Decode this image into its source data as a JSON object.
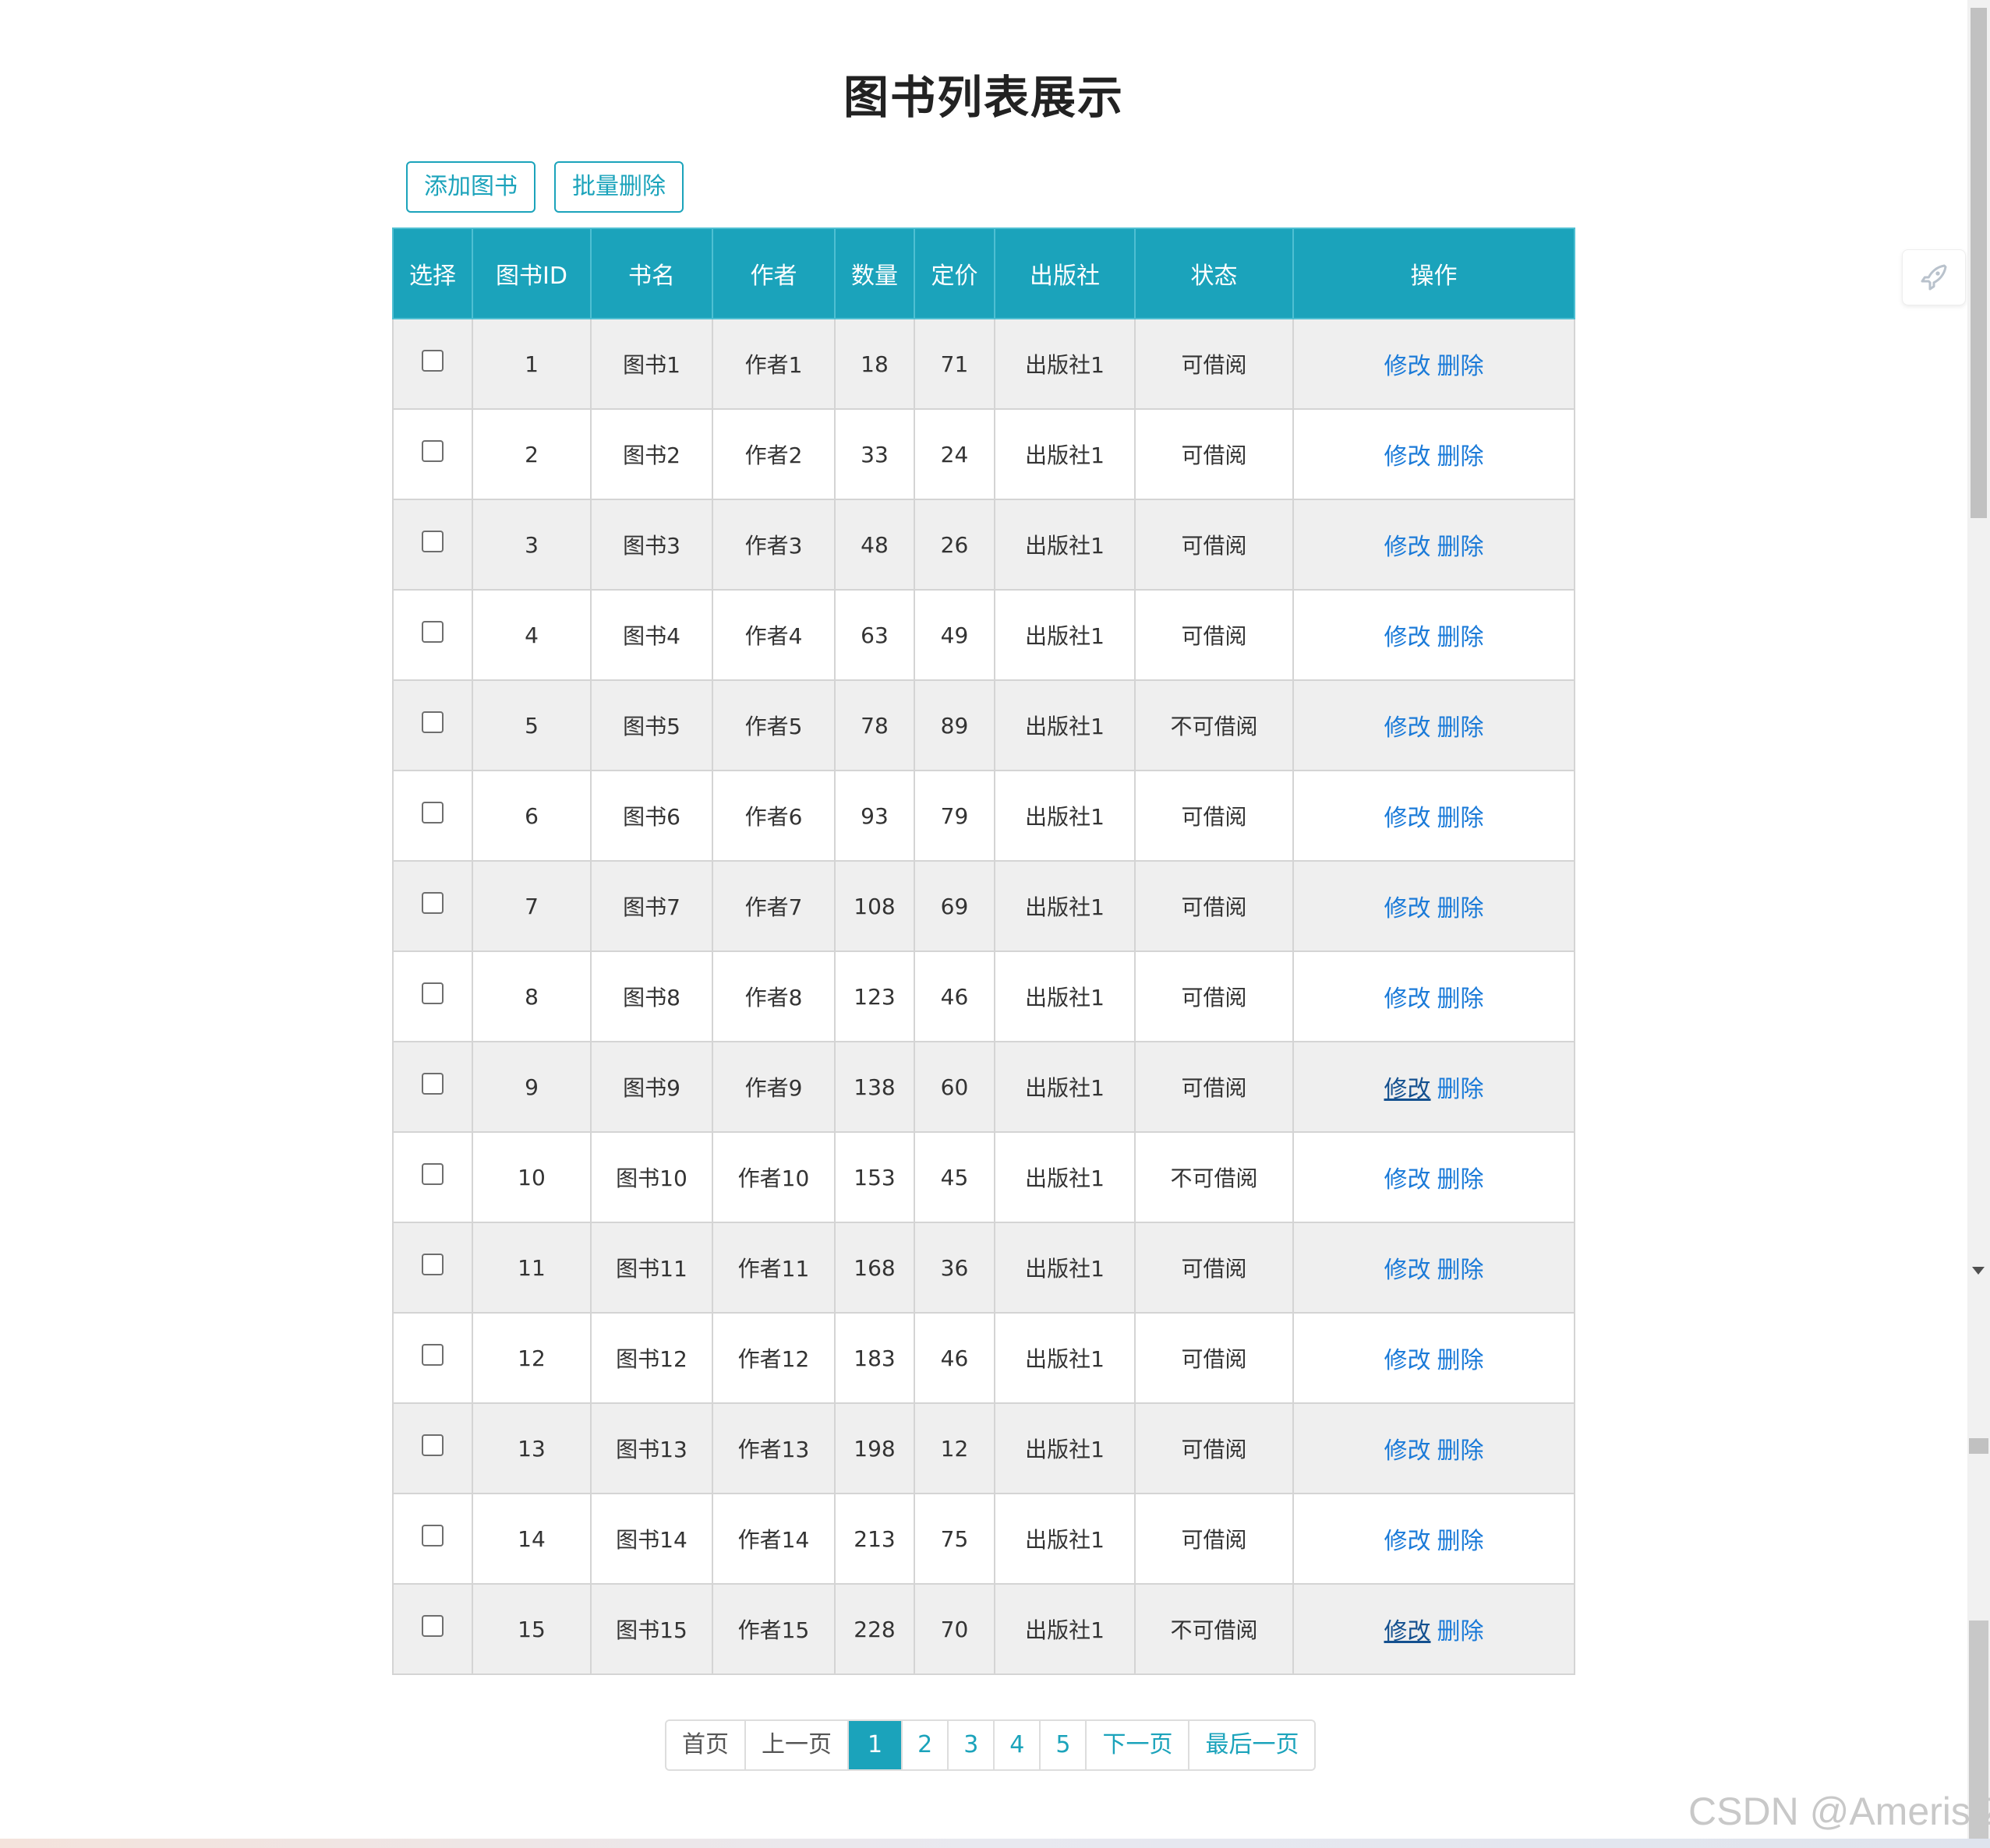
{
  "page": {
    "title": "图书列表展示"
  },
  "toolbar": {
    "add_label": "添加图书",
    "batch_delete_label": "批量删除"
  },
  "table": {
    "headers": [
      "选择",
      "图书ID",
      "书名",
      "作者",
      "数量",
      "定价",
      "出版社",
      "状态",
      "操作"
    ],
    "edit_label": "修改",
    "delete_label": "删除",
    "rows": [
      {
        "id": "1",
        "name": "图书1",
        "author": "作者1",
        "count": "18",
        "price": "71",
        "publisher": "出版社1",
        "status": "可借阅"
      },
      {
        "id": "2",
        "name": "图书2",
        "author": "作者2",
        "count": "33",
        "price": "24",
        "publisher": "出版社1",
        "status": "可借阅"
      },
      {
        "id": "3",
        "name": "图书3",
        "author": "作者3",
        "count": "48",
        "price": "26",
        "publisher": "出版社1",
        "status": "可借阅"
      },
      {
        "id": "4",
        "name": "图书4",
        "author": "作者4",
        "count": "63",
        "price": "49",
        "publisher": "出版社1",
        "status": "可借阅"
      },
      {
        "id": "5",
        "name": "图书5",
        "author": "作者5",
        "count": "78",
        "price": "89",
        "publisher": "出版社1",
        "status": "不可借阅"
      },
      {
        "id": "6",
        "name": "图书6",
        "author": "作者6",
        "count": "93",
        "price": "79",
        "publisher": "出版社1",
        "status": "可借阅"
      },
      {
        "id": "7",
        "name": "图书7",
        "author": "作者7",
        "count": "108",
        "price": "69",
        "publisher": "出版社1",
        "status": "可借阅"
      },
      {
        "id": "8",
        "name": "图书8",
        "author": "作者8",
        "count": "123",
        "price": "46",
        "publisher": "出版社1",
        "status": "可借阅"
      },
      {
        "id": "9",
        "name": "图书9",
        "author": "作者9",
        "count": "138",
        "price": "60",
        "publisher": "出版社1",
        "status": "可借阅"
      },
      {
        "id": "10",
        "name": "图书10",
        "author": "作者10",
        "count": "153",
        "price": "45",
        "publisher": "出版社1",
        "status": "不可借阅"
      },
      {
        "id": "11",
        "name": "图书11",
        "author": "作者11",
        "count": "168",
        "price": "36",
        "publisher": "出版社1",
        "status": "可借阅"
      },
      {
        "id": "12",
        "name": "图书12",
        "author": "作者12",
        "count": "183",
        "price": "46",
        "publisher": "出版社1",
        "status": "可借阅"
      },
      {
        "id": "13",
        "name": "图书13",
        "author": "作者13",
        "count": "198",
        "price": "12",
        "publisher": "出版社1",
        "status": "可借阅"
      },
      {
        "id": "14",
        "name": "图书14",
        "author": "作者14",
        "count": "213",
        "price": "75",
        "publisher": "出版社1",
        "status": "可借阅"
      },
      {
        "id": "15",
        "name": "图书15",
        "author": "作者15",
        "count": "228",
        "price": "70",
        "publisher": "出版社1",
        "status": "不可借阅"
      }
    ]
  },
  "pagination": {
    "first": "首页",
    "prev": "上一页",
    "pages": [
      "1",
      "2",
      "3",
      "4",
      "5"
    ],
    "current": "1",
    "next": "下一页",
    "last": "最后一页"
  },
  "watermark": "CSDN @Ameris Z",
  "colors": {
    "accent": "#1ba3bb",
    "link": "#1a7ad8",
    "row_alt": "#efefef"
  },
  "icons": {
    "float_widget": "rocket-icon"
  }
}
